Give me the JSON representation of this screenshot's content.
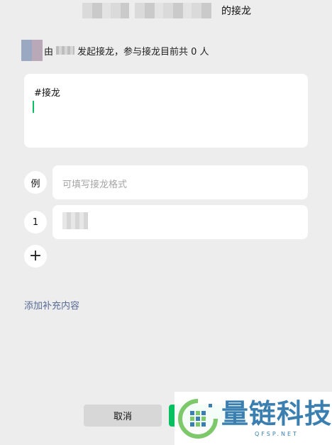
{
  "header": {
    "title_suffix": "的接龙"
  },
  "initiator": {
    "prefix": "由",
    "suffix": "发起接龙，参与接龙目前共 0 人"
  },
  "main_input": {
    "value": "#接龙"
  },
  "example_row": {
    "badge": "例",
    "placeholder": "可填写接龙格式"
  },
  "entries": [
    {
      "index": "1"
    }
  ],
  "add_extra_label": "添加补充内容",
  "buttons": {
    "cancel": "取消"
  },
  "watermark": {
    "title": "量链科技",
    "subtitle": "QFSP.NET"
  },
  "colors": {
    "accent_green": "#07c160",
    "link_blue": "#576b95",
    "background": "#ededed"
  }
}
